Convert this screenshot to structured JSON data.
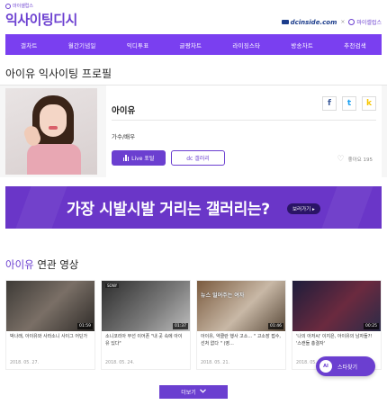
{
  "header": {
    "brand_small": "마이셀럽스",
    "logo_main": "익사이팅",
    "logo_accent": "디시",
    "partner_dc": "dcinside.com",
    "partner_sep": "×",
    "partner_mai": "마이셀럽스"
  },
  "nav": {
    "items": [
      "갤차트",
      "월간기념일",
      "익디투표",
      "글짱차트",
      "라이징스타",
      "방송차트",
      "추천검색"
    ]
  },
  "profile": {
    "page_title": "아이유 익사이팅 프로필",
    "name": "아이유",
    "job": "가수/배우",
    "live_button": "Live 포털",
    "gallery_button": "dc 갤러리",
    "like_label": "좋아요 195",
    "share_fb": "f",
    "share_tw": "t",
    "share_ks": "k"
  },
  "banner": {
    "text": "가장 시발시발 거리는 갤러리는?",
    "button": "보러가기 ▸"
  },
  "videos_section": {
    "title_highlight": "아이유",
    "title_rest": " 연관 영상",
    "items": [
      {
        "title": "박나래, 아이유와 사라소니 사이그 어딘가",
        "date": "2018. 05. 27.",
        "duration": "01:59",
        "thumb_label": "",
        "thumb_caption": ""
      },
      {
        "title": "소니코리아 무선 이어폰 \"내 곳 속에 아이유 있다\"",
        "date": "2018. 05. 24.",
        "duration": "01:37",
        "thumb_label": "SONY",
        "thumb_caption": ""
      },
      {
        "title": "아이유, 약클란 행사 고소… \" 고소장 접수, 선처 없다 \" (영...",
        "date": "2018. 05. 21.",
        "duration": "01:46",
        "thumb_label": "",
        "thumb_caption": "뉴스 일어주는 여자"
      },
      {
        "title": "'나의 아저씨' 이지은, 아이유의 남자들?! '스캔들 총결자'",
        "date": "2018. 05.",
        "duration": "00:25",
        "thumb_label": "",
        "thumb_caption": ""
      }
    ]
  },
  "star_button": {
    "ai": "AI",
    "label": "스타찾기"
  },
  "more_button": "더보기"
}
